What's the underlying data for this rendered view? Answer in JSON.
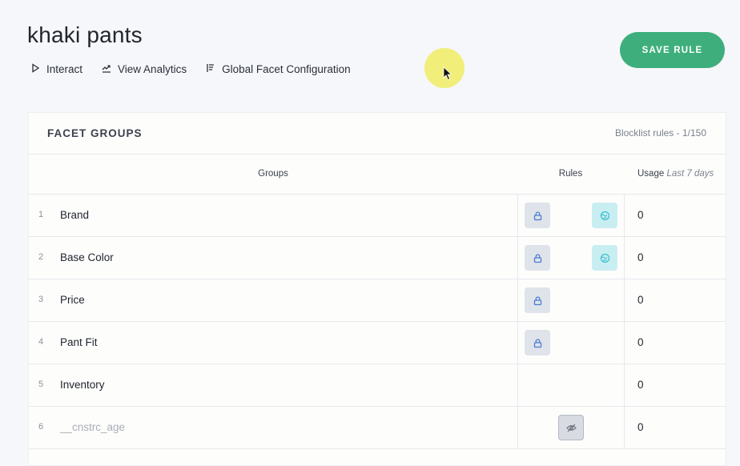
{
  "page": {
    "title": "khaki pants",
    "actions": [
      {
        "label": "Interact",
        "icon": "play-icon"
      },
      {
        "label": "View Analytics",
        "icon": "analytics-icon"
      },
      {
        "label": "Global Facet Configuration",
        "icon": "list-icon"
      }
    ],
    "save_label": "SAVE RULE"
  },
  "panel": {
    "title": "FACET GROUPS",
    "blocklist": "Blocklist rules - 1/150",
    "columns": {
      "groups": "Groups",
      "rules": "Rules",
      "usage": "Usage",
      "usage_note": "Last 7 days"
    }
  },
  "rows": [
    {
      "num": "1",
      "name": "Brand",
      "usage": "0"
    },
    {
      "num": "2",
      "name": "Base Color",
      "usage": "0"
    },
    {
      "num": "3",
      "name": "Price",
      "usage": "0"
    },
    {
      "num": "4",
      "name": "Pant Fit",
      "usage": "0"
    },
    {
      "num": "5",
      "name": "Inventory",
      "usage": "0"
    },
    {
      "num": "6",
      "name": "__cnstrc_age",
      "usage": "0"
    }
  ],
  "colors": {
    "accent": "#3eaf7c",
    "lock_chip": "#dfe3ea",
    "globe_chip": "#c9eef2",
    "icon_blue": "#4a7bd0",
    "icon_teal": "#3bbfcf"
  }
}
